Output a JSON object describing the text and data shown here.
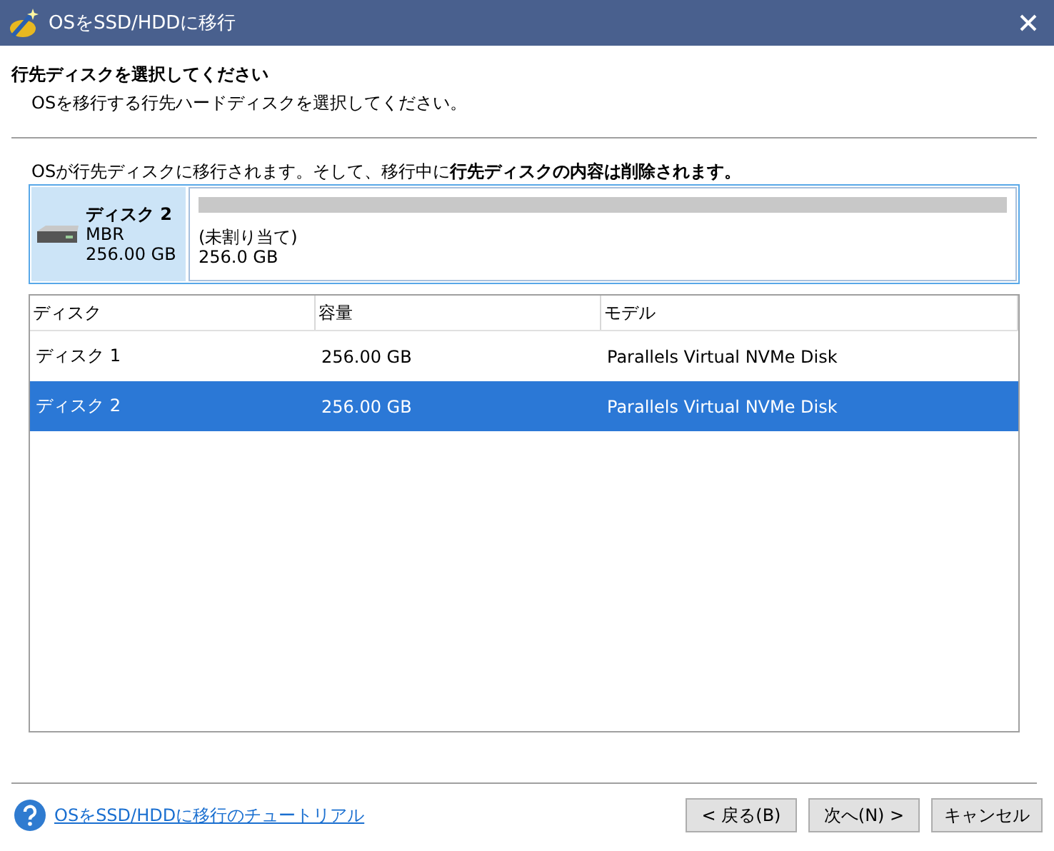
{
  "window": {
    "title": "OSをSSD/HDDに移行"
  },
  "header": {
    "title": "行先ディスクを選択してください",
    "subtitle": "OSを移行する行先ハードディスクを選択してください。"
  },
  "warning": "OSが行先ディスクに移行されます。そして、移行中に**行先ディスクの内容は削除されます。**",
  "disk_card": {
    "name": "ディスク 2",
    "type": "MBR",
    "size": "256.00 GB",
    "selected": true,
    "partition": {
      "label": "(未割り当て)",
      "size": "256.0 GB"
    }
  },
  "table": {
    "columns": [
      "ディスク",
      "容量",
      "モデル"
    ],
    "rows": [
      {
        "cells": [
          "ディスク 1",
          "256.00 GB",
          "Parallels Virtual NVMe Disk"
        ],
        "selected": false
      },
      {
        "cells": [
          "ディスク 2",
          "256.00 GB",
          "Parallels Virtual NVMe Disk"
        ],
        "selected": true
      }
    ]
  },
  "footer": {
    "tutorial_link": "OSをSSD/HDDに移行のチュートリアル",
    "buttons": [
      "< 戻る(B)",
      "次へ(N) >",
      "キャンセル"
    ]
  }
}
